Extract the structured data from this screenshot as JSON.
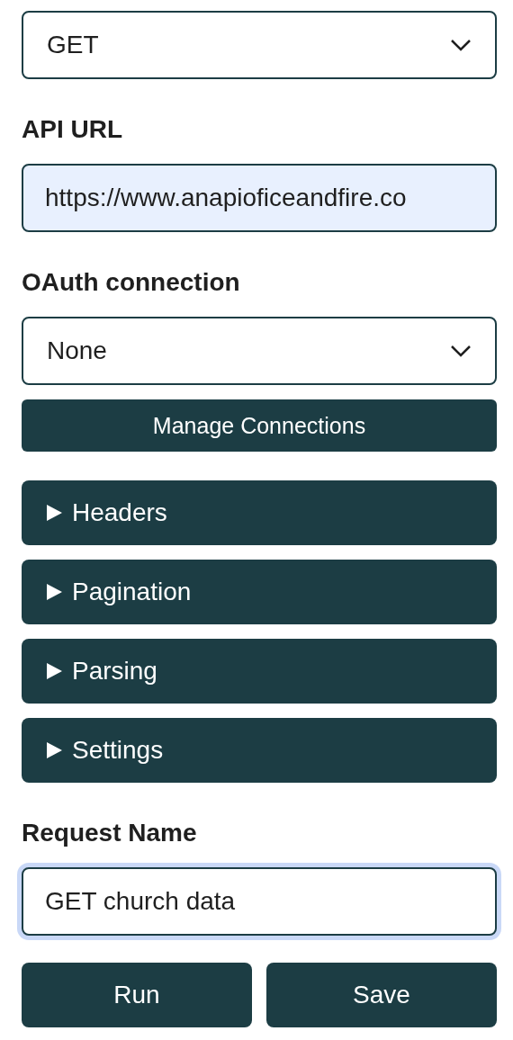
{
  "method_select": {
    "value": "GET"
  },
  "api_url": {
    "label": "API URL",
    "value": "https://www.anapioficeandfire.co"
  },
  "oauth": {
    "label": "OAuth connection",
    "value": "None"
  },
  "manage_button": "Manage Connections",
  "sections": [
    {
      "label": "Headers",
      "expanded": false
    },
    {
      "label": "Pagination",
      "expanded": false
    },
    {
      "label": "Parsing",
      "expanded": false
    },
    {
      "label": "Settings",
      "expanded": false
    }
  ],
  "request_name": {
    "label": "Request Name",
    "value": "GET church data",
    "focused": true
  },
  "buttons": [
    "Run",
    "Save"
  ]
}
